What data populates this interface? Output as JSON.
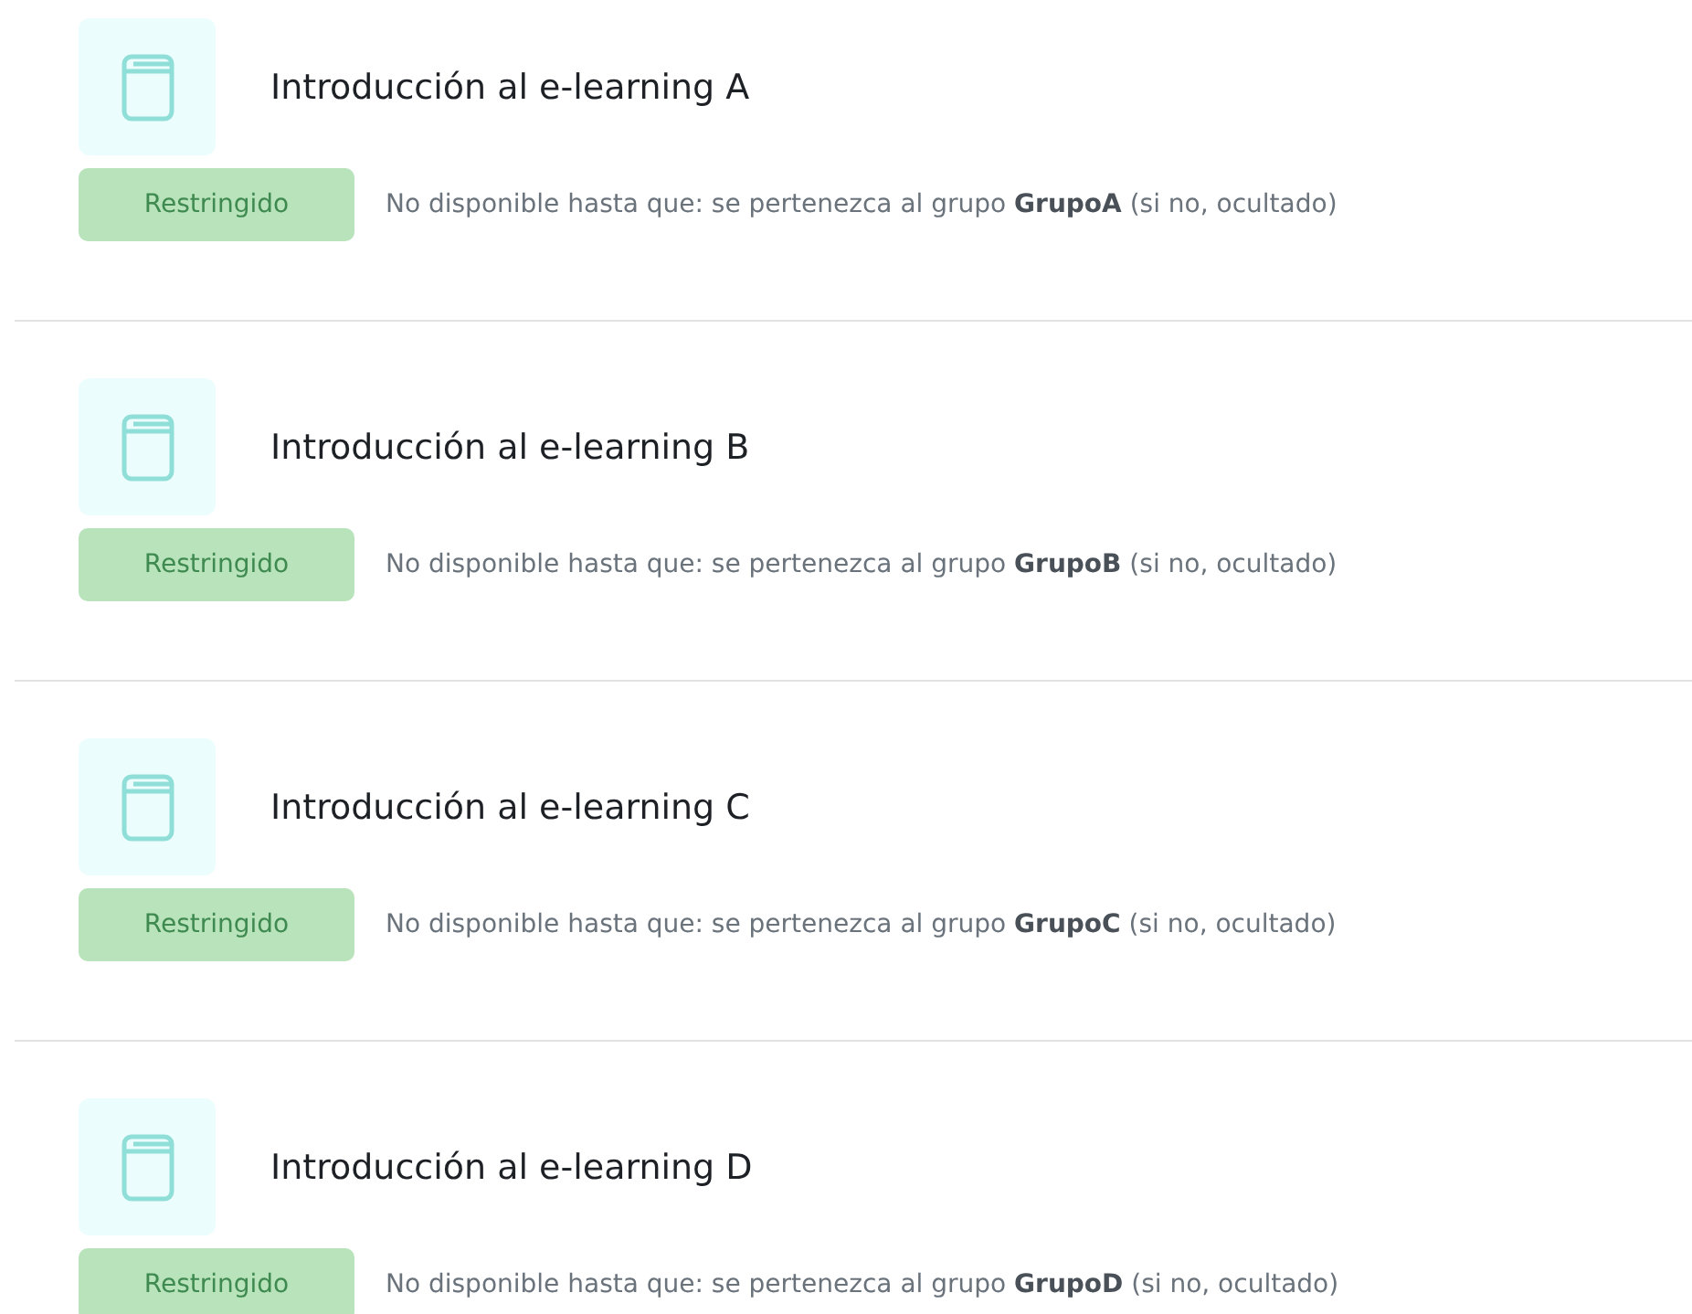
{
  "activities": [
    {
      "title": "Introducción al e-learning A",
      "badge": "Restringido",
      "restriction": "No disponible hasta que: se pertenezca al grupo **GrupoA** (si no, ocultado)"
    },
    {
      "title": "Introducción al e-learning B",
      "badge": "Restringido",
      "restriction": "No disponible hasta que: se pertenezca al grupo **GrupoB** (si no, ocultado)"
    },
    {
      "title": "Introducción al e-learning C",
      "badge": "Restringido",
      "restriction": "No disponible hasta que: se pertenezca al grupo **GrupoC** (si no, ocultado)"
    },
    {
      "title": "Introducción al e-learning D",
      "badge": "Restringido",
      "restriction": "No disponible hasta que: se pertenezca al grupo **GrupoD** (si no, ocultado)"
    }
  ]
}
